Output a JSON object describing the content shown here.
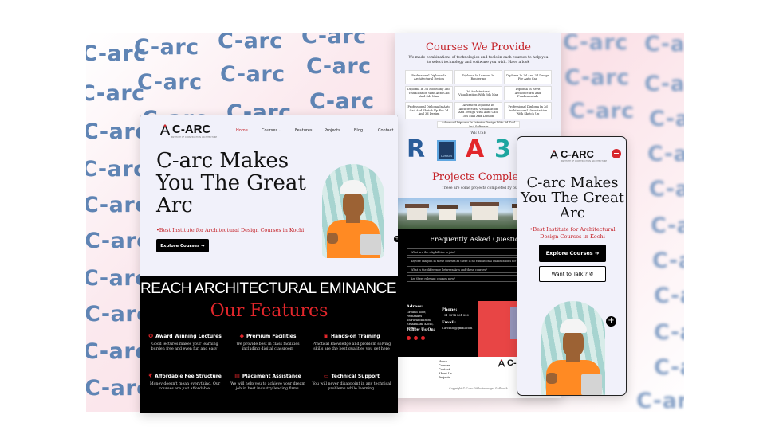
{
  "watermark": {
    "text": "C-arc"
  },
  "brand": {
    "logo_text": "C-ARC",
    "logo_subtext": "INSTITUTE OF CONSTRUCTION ARCHITECTURE"
  },
  "desktop": {
    "nav": {
      "home": "Home",
      "courses": "Courses",
      "features": "Features",
      "projects": "Projects",
      "blog": "Blog",
      "contact": "Contact"
    },
    "hero": {
      "title": "C-arc Makes You The Great Arc",
      "tagline": "Best Institute for Architectural Design Courses in Kochi",
      "cta": "Explore Courses"
    },
    "reach": "REACH ARCHITECTURAL EMINANCE WITH C",
    "features_title": "Our Features",
    "features": [
      {
        "icon": "award-icon",
        "glyph": "✪",
        "title": "Award Winning Lectures",
        "desc": "Good lectures makes your learning burden free and even fun and easy!"
      },
      {
        "icon": "diamond-icon",
        "glyph": "◆",
        "title": "Premium Facilities",
        "desc": "We provide best in class facilities including digital classroom"
      },
      {
        "icon": "book-icon",
        "glyph": "▣",
        "title": "Hands-on Training",
        "desc": "Practical knowledge and problem solving skills are the best qualities you get here"
      },
      {
        "icon": "rupee-icon",
        "glyph": "₹",
        "title": "Affordable Fee Structure",
        "desc": "Money doesn't mean everything. Our courses are just affordable."
      },
      {
        "icon": "building-icon",
        "glyph": "▤",
        "title": "Placement Assistance",
        "desc": "We will help you to achieve your dream job in best industry leading firms."
      },
      {
        "icon": "laptop-icon",
        "glyph": "▭",
        "title": "Technical Support",
        "desc": "You will never disappoint in any technical problems while learning."
      }
    ]
  },
  "middle": {
    "courses_title": "Courses We Provide",
    "courses_desc": "We made combinations of technologies and tools in each courses to help you to select technology and software you wish. Have a look",
    "courses": [
      "Professional Diploma In Architectural Design",
      "Diploma In Lumion 3d Rendering",
      "Diploma In 3d And 3d Design For Auto Cad",
      "Diploma In 3d Modelling And Visualization With Auto Cad And 3ds Max",
      "3d Architectural Visualization With 3ds Max",
      "Diploma In Revit Architectural And Fundamentals",
      "Professional Diploma In Auto Cad And Sketch Up For 2d And 3d Design",
      "Advanced Diploma In Architectural Visualization And Design With Auto Cad, 3ds Max And Lumion",
      "Professional Diploma In 3d Architectural Visualization With Sketch Up"
    ],
    "course_wide": "Advanced Diploma In Interior Design With 3d Tool And Software",
    "we_use": "WE USE",
    "tools": [
      "R",
      "LUMION",
      "A",
      "3"
    ],
    "projects_title": "Projects Completed",
    "projects_desc": "These are some projects completed by our students",
    "faq_title": "Frequently Asked Questions",
    "faqs": [
      "What are the eligibilities to join?",
      "Anyone can join in these courses as there is no educational qualifications for these diploma courses. But the",
      "What is the difference between Arts and these courses?",
      "Are there relevant courses now?"
    ],
    "address_label": "Adress:",
    "address": "Ground floor, Fernandes Thiruvanthuram, Ernakulam, Kochi, Kerala",
    "phone_label": "Phone:",
    "phone": "+91 9874 561 230",
    "email_label": "Email:",
    "email": "c.arcinfo@gmail.com",
    "follow": "Follow Us On:",
    "footer_links": [
      "Home",
      "Courses",
      "Contact",
      "About Us",
      "Projects"
    ],
    "copyright": "Copyright © C-arc. Websitedesign: Gadbrush"
  },
  "mobile": {
    "title": "C-arc Makes You The Great Arc",
    "tagline": "Best Institute for Architectural Design Courses in Kochi",
    "cta_primary": "Explore Courses",
    "cta_secondary": "Want to Talk ?"
  }
}
